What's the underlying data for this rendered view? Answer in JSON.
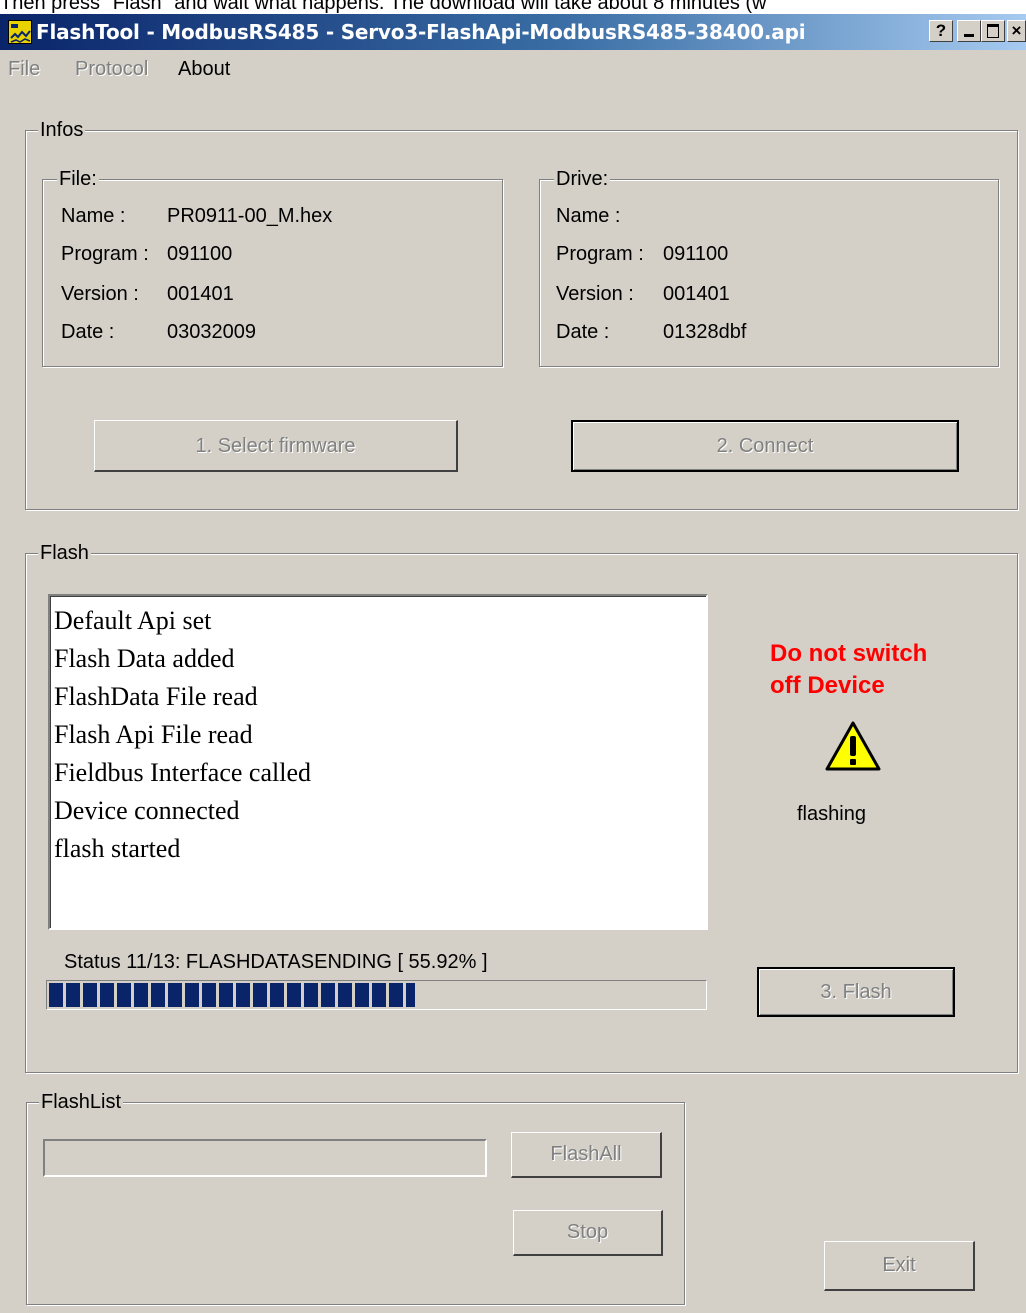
{
  "caption": "Then press \"Flash\" and wait what happens. The download will take about 8 minutes (w",
  "window": {
    "title": "FlashTool - ModbusRS485 - Servo3-FlashApi-ModbusRS485-38400.api",
    "help_button": "?",
    "minimize_button": "_",
    "maximize_button": "□",
    "close_button": "×"
  },
  "menu": {
    "file": "File",
    "protocol": "Protocol",
    "about": "About"
  },
  "infos": {
    "legend": "Infos",
    "file": {
      "legend": "File:",
      "name_label": "Name :",
      "name_value": "PR0911-00_M.hex",
      "program_label": "Program :",
      "program_value": "091100",
      "version_label": "Version :",
      "version_value": "001401",
      "date_label": "Date :",
      "date_value": "03032009"
    },
    "drive": {
      "legend": "Drive:",
      "name_label": "Name :",
      "name_value": "",
      "program_label": "Program :",
      "program_value": "091100",
      "version_label": "Version :",
      "version_value": "001401",
      "date_label": "Date :",
      "date_value": "01328dbf"
    },
    "select_firmware_button": "1.  Select firmware",
    "connect_button": "2.  Connect"
  },
  "flash": {
    "legend": "Flash",
    "log": [
      "Default Api set",
      "Flash Data added",
      "FlashData File read",
      "Flash Api File read",
      "Fieldbus Interface called",
      "Device connected",
      "flash started"
    ],
    "warning_line1": "Do not switch",
    "warning_line2": "off Device",
    "warning_icon": "warning-triangle-icon",
    "warning_color": "#ff0000",
    "state_text": "flashing",
    "status_text": "Status   11/13: FLASHDATASENDING [ 55.92% ]",
    "progress_fraction": 0.5592,
    "flash_button": "3.  Flash"
  },
  "flashlist": {
    "legend": "FlashList",
    "combo_value": "",
    "flash_all_button": "FlashAll",
    "stop_button": "Stop"
  },
  "exit_button": "Exit"
}
